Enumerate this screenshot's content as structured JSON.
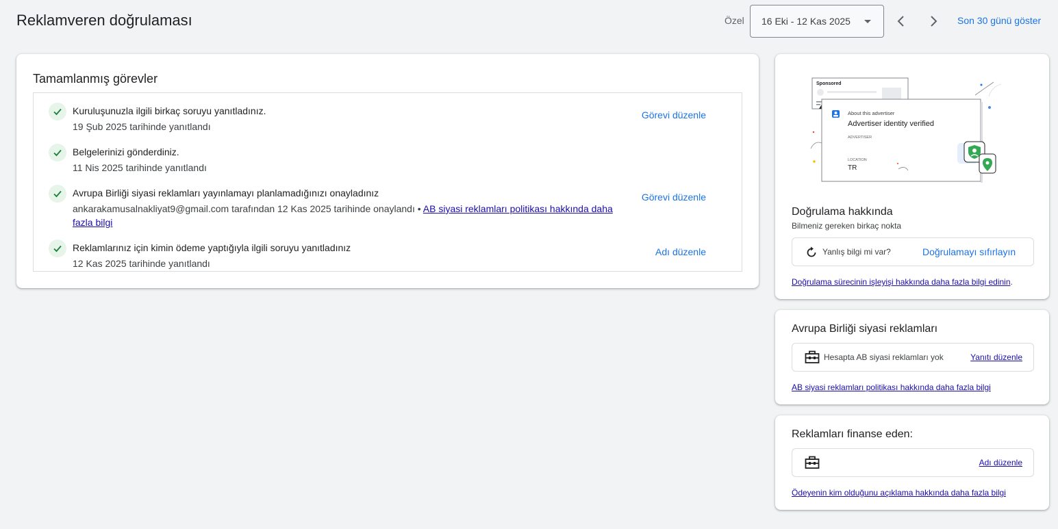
{
  "header": {
    "title": "Reklamveren doğrulaması",
    "date_label": "Özel",
    "date_range": "16 Eki - 12 Kas 2025",
    "last_30_label": "Son 30 günü göster"
  },
  "tasks_card": {
    "title": "Tamamlanmış görevler",
    "tasks": [
      {
        "title": "Kuruluşunuzla ilgili birkaç soruyu yanıtladınız.",
        "subtitle": "19 Şub 2025 tarihinde yanıtlandı",
        "action": "Görevi düzenle"
      },
      {
        "title": "Belgelerinizi gönderdiniz.",
        "subtitle": "11 Nis 2025 tarihinde yanıtlandı",
        "action": ""
      },
      {
        "title": "Avrupa Birliği siyasi reklamları yayınlamayı planlamadığınızı onayladınız",
        "subtitle": "ankarakamusalnakliyat9@gmail.com tarafından 12 Kas 2025 tarihinde onaylandı •",
        "subtitle_link": "AB siyasi reklamları politikası hakkında daha fazla bilgi",
        "action": "Görevi düzenle"
      },
      {
        "title": "Reklamlarınız için kimin ödeme yaptığıyla ilgili soruyu yanıtladınız",
        "subtitle": "12 Kas 2025 tarihinde yanıtlandı",
        "action": "Adı düzenle"
      }
    ]
  },
  "verification_card": {
    "illustration": {
      "sponsored": "Sponsored",
      "about": "About this advertiser",
      "verified": "Advertiser identity verified",
      "advertiser": "ADVERTISER",
      "location_label": "LOCATION",
      "location_value": "TR"
    },
    "title": "Doğrulama hakkında",
    "subtitle": "Bilmeniz gereken birkaç nokta",
    "wrong_info": "Yanlış bilgi mi var?",
    "reset_link": "Doğrulamayı sıfırlayın",
    "footer_link": "Doğrulama sürecinin işleyişi hakkında daha fazla bilgi edinin",
    "footer_suffix": "."
  },
  "eu_card": {
    "title": "Avrupa Birliği siyasi reklamları",
    "status": "Hesapta AB siyasi reklamları yok",
    "edit_link": "Yanıtı düzenle",
    "footer_link": "AB siyasi reklamları politikası hakkında daha fazla bilgi"
  },
  "finance_card": {
    "title": "Reklamları finanse eden:",
    "edit_link": "Adı düzenle",
    "footer_link": "Ödeyenin kim olduğunu açıklama hakkında daha fazla bilgi"
  },
  "colors": {
    "accent": "#1a73e8",
    "link": "#1a0dab",
    "check": "#188038",
    "check_bg": "#e6f4ea",
    "background": "#f1f3f4"
  }
}
